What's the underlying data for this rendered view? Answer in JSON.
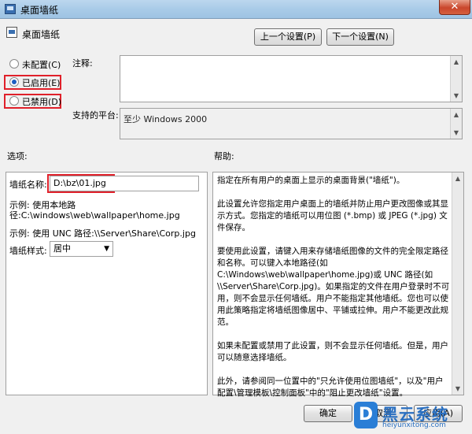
{
  "window": {
    "title": "桌面墙纸",
    "close_glyph": "✕"
  },
  "header": {
    "title": "桌面墙纸"
  },
  "nav": {
    "prev_label": "上一个设置(P)",
    "next_label": "下一个设置(N)"
  },
  "state": {
    "options": [
      {
        "label": "未配置(C)",
        "checked": false
      },
      {
        "label": "已启用(E)",
        "checked": true
      },
      {
        "label": "已禁用(D)",
        "checked": false
      }
    ]
  },
  "comment": {
    "label": "注释:",
    "value": ""
  },
  "platform": {
    "label": "支持的平台:",
    "value": "至少 Windows 2000"
  },
  "options_section": {
    "label": "选项:",
    "wallpaper_name_label": "墙纸名称:",
    "wallpaper_name_value": "D:\\bz\\01.jpg",
    "example_local_line1": "示例: 使用本地路",
    "example_local_line2": "径:C:\\windows\\web\\wallpaper\\home.jpg",
    "example_unc": "示例: 使用 UNC 路径:\\\\Server\\Share\\Corp.jpg",
    "style_label": "墙纸样式:",
    "style_value": "居中"
  },
  "help_section": {
    "label": "帮助:",
    "paragraphs": [
      "指定在所有用户的桌面上显示的桌面背景(\"墙纸\")。",
      "此设置允许您指定用户桌面上的墙纸并防止用户更改图像或其显示方式。您指定的墙纸可以用位图 (*.bmp) 或 JPEG (*.jpg) 文件保存。",
      "要使用此设置，请键入用来存储墙纸图像的文件的完全限定路径和名称。可以键入本地路径(如 C:\\Windows\\web\\wallpaper\\home.jpg)或 UNC 路径(如 \\\\Server\\Share\\Corp.jpg)。如果指定的文件在用户登录时不可用，则不会显示任何墙纸。用户不能指定其他墙纸。您也可以使用此策略指定将墙纸图像居中、平铺或拉伸。用户不能更改此规范。",
      "如果未配置或禁用了此设置，则不会显示任何墙纸。但是，用户可以随意选择墙纸。",
      "此外，请参阅同一位置中的\"只允许使用位图墙纸\"，以及\"用户配置\\管理模板\\控制面板\"中的\"阻止更改墙纸\"设置。"
    ]
  },
  "footer": {
    "ok_label": "确定",
    "cancel_label": "取消",
    "apply_label": "应用(A)"
  },
  "watermark": {
    "logo_letter": "D",
    "title": "黑云系统",
    "url": "heiyunxitong.com"
  },
  "colors": {
    "highlight": "#e0202a",
    "accent": "#2a6fc0"
  }
}
